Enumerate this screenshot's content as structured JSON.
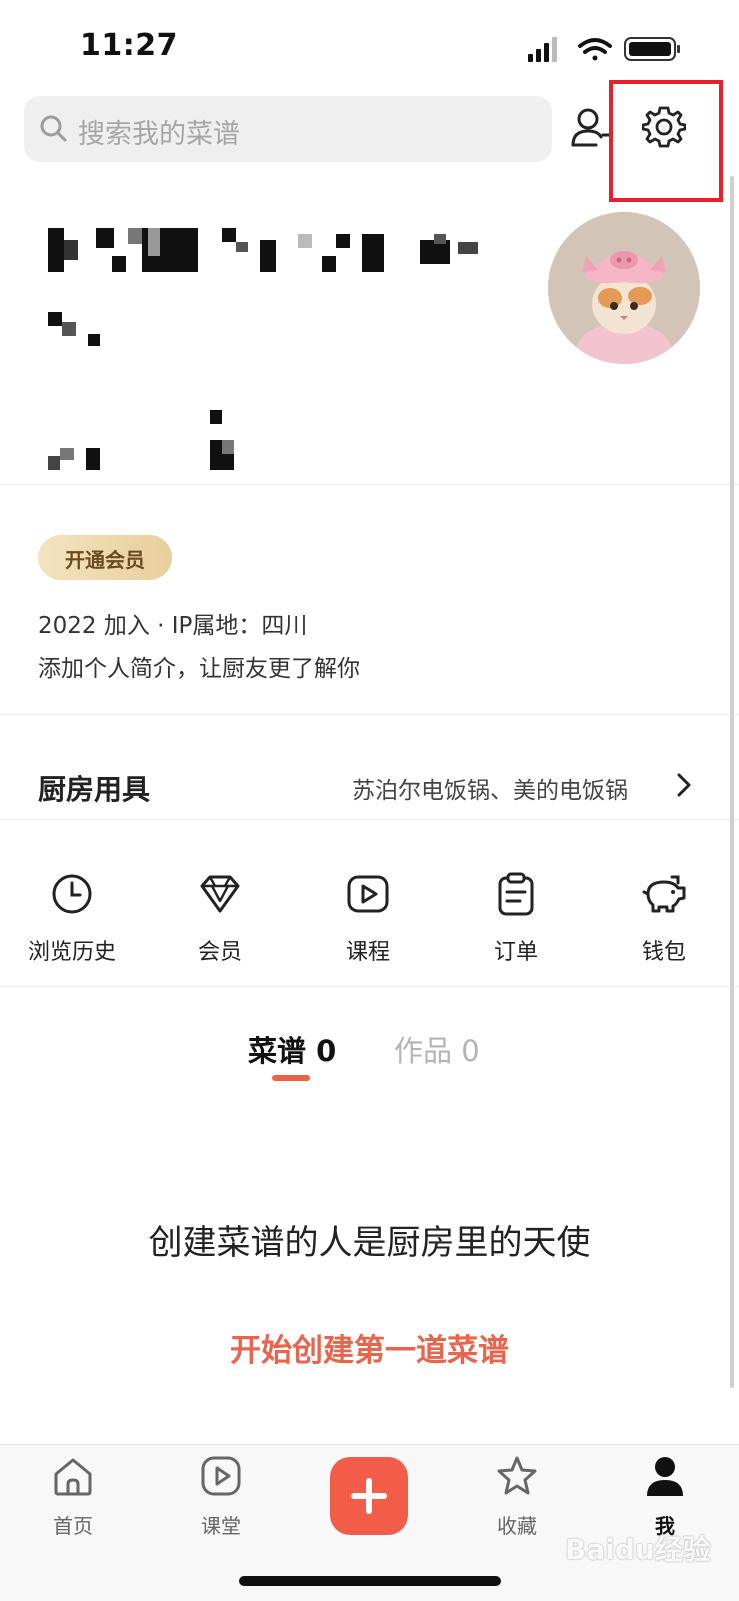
{
  "status_bar": {
    "time": "11:27"
  },
  "search": {
    "placeholder": "搜索我的菜谱"
  },
  "profile": {
    "join_info": "2022 加入 · IP属地：四川",
    "bio_placeholder": "添加个人简介，让厨友更了解你",
    "vip_label": "开通会员"
  },
  "kitchen_tools": {
    "label": "厨房用具",
    "value": "苏泊尔电饭锅、美的电饭锅"
  },
  "quick_links": [
    {
      "label": "浏览历史",
      "icon": "clock-icon"
    },
    {
      "label": "会员",
      "icon": "diamond-icon"
    },
    {
      "label": "课程",
      "icon": "play-icon"
    },
    {
      "label": "订单",
      "icon": "clipboard-icon"
    },
    {
      "label": "钱包",
      "icon": "piggy-bank-icon"
    }
  ],
  "tabs": [
    {
      "label": "菜谱 0",
      "active": true
    },
    {
      "label": "作品 0",
      "active": false
    }
  ],
  "empty_state": {
    "title": "创建菜谱的人是厨房里的天使",
    "cta": "开始创建第一道菜谱"
  },
  "bottom_nav": [
    {
      "label": "首页",
      "icon": "home-icon"
    },
    {
      "label": "课堂",
      "icon": "play-icon"
    },
    {
      "label": "",
      "icon": "plus-icon"
    },
    {
      "label": "收藏",
      "icon": "star-icon"
    },
    {
      "label": "我",
      "icon": "user-icon",
      "active": true
    }
  ],
  "watermark": "Baidu经验",
  "colors": {
    "accent": "#f25d4a",
    "cta_text": "#e8654d",
    "highlight_box": "#e8202a",
    "vip_gold": "#e8cf9c"
  }
}
